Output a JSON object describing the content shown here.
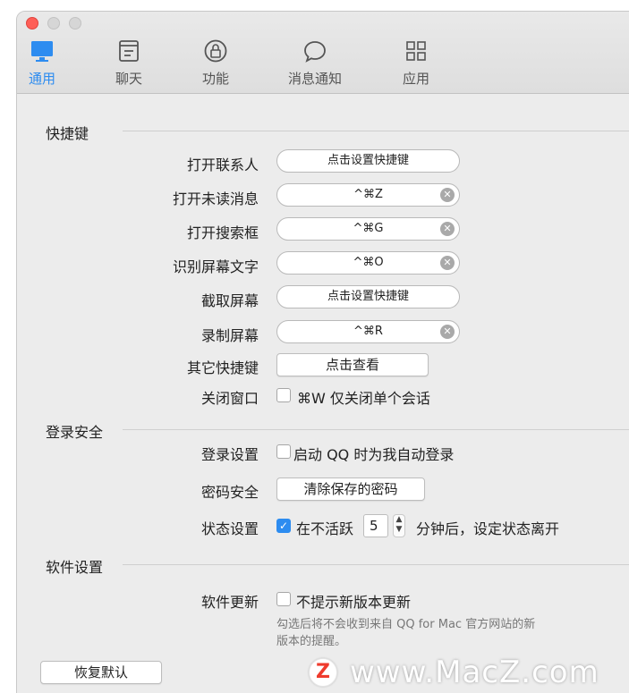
{
  "tabs": [
    {
      "label": "通用",
      "icon": "monitor-icon",
      "active": true
    },
    {
      "label": "聊天",
      "icon": "chat-window-icon",
      "active": false
    },
    {
      "label": "功能",
      "icon": "lock-icon",
      "active": false
    },
    {
      "label": "消息通知",
      "icon": "speech-bubble-icon",
      "active": false
    },
    {
      "label": "应用",
      "icon": "grid-icon",
      "active": false
    }
  ],
  "shortcuts": {
    "title": "快捷键",
    "rows": [
      {
        "label": "打开联系人",
        "value": "点击设置快捷键",
        "clearable": false
      },
      {
        "label": "打开未读消息",
        "value": "^⌘Z",
        "clearable": true
      },
      {
        "label": "打开搜索框",
        "value": "^⌘G",
        "clearable": true
      },
      {
        "label": "识别屏幕文字",
        "value": "^⌘O",
        "clearable": true
      },
      {
        "label": "截取屏幕",
        "value": "点击设置快捷键",
        "clearable": false
      },
      {
        "label": "录制屏幕",
        "value": "^⌘R",
        "clearable": true
      }
    ],
    "other_label": "其它快捷键",
    "other_button": "点击查看",
    "close_label": "关闭窗口",
    "close_option": "⌘W 仅关闭单个会话",
    "close_checked": false
  },
  "login": {
    "title": "登录安全",
    "settings_label": "登录设置",
    "auto_login": "启动 QQ 时为我自动登录",
    "auto_login_checked": false,
    "password_label": "密码安全",
    "clear_password_button": "清除保存的密码",
    "status_label": "状态设置",
    "inactive_checked": true,
    "inactive_prefix": "在不活跃",
    "inactive_minutes": "5",
    "inactive_suffix": "分钟后，设定状态离开"
  },
  "software": {
    "title": "软件设置",
    "update_label": "软件更新",
    "no_update_prompt": "不提示新版本更新",
    "no_update_checked": false,
    "hint": "勾选后将不会收到来自 QQ for Mac 官方网站的新版本的提醒。"
  },
  "restore_button": "恢复默认",
  "watermark": {
    "logo": "Z",
    "text": "www.MacZ.com"
  },
  "colors": {
    "accent": "#2d8cf0",
    "close": "#fe5f57"
  }
}
